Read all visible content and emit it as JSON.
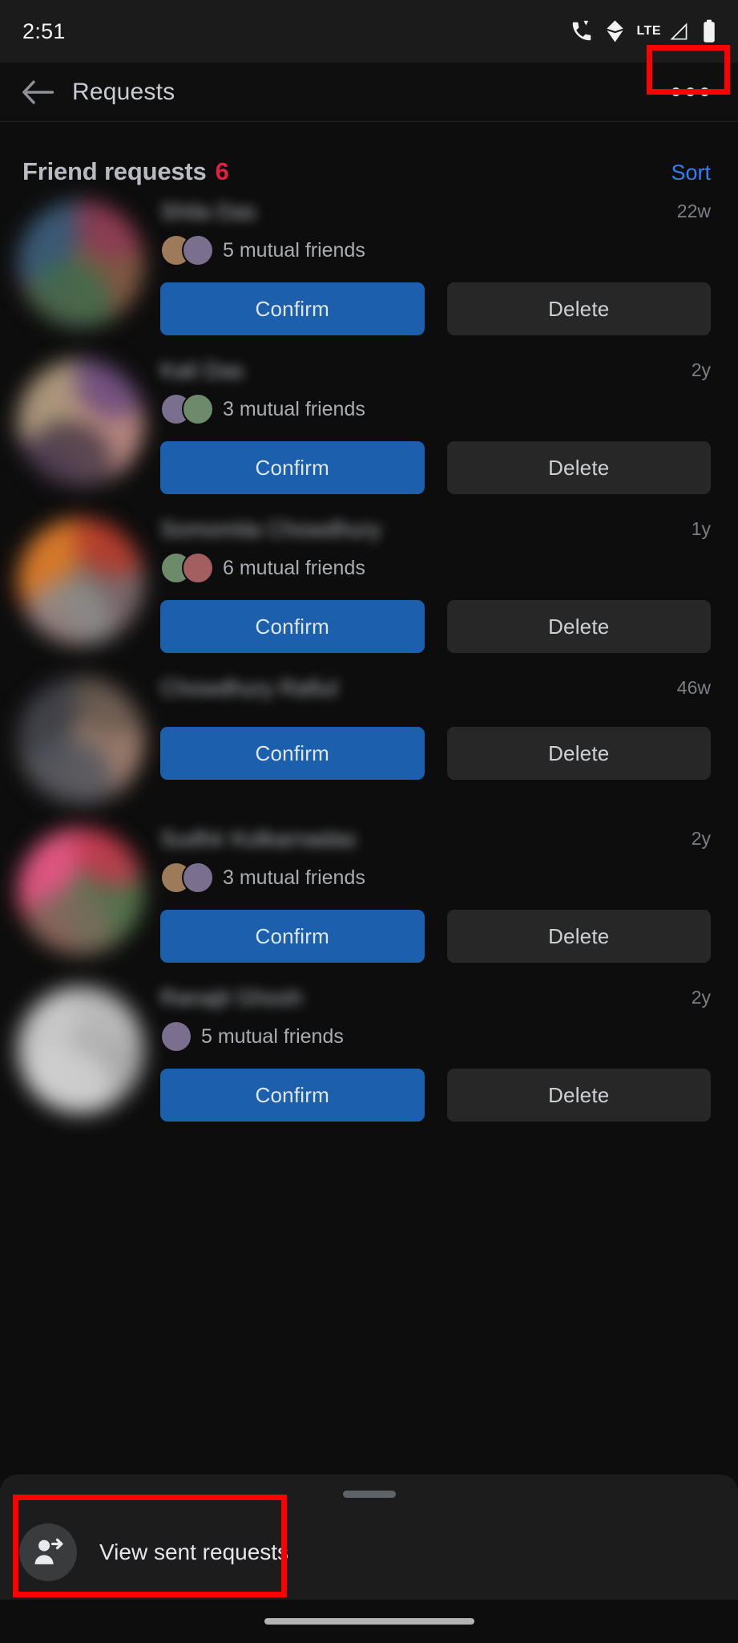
{
  "status_bar": {
    "time": "2:51",
    "network_label": "LTE",
    "icons": [
      "call-icon",
      "vpn-key-icon",
      "lte-label",
      "signal-icon",
      "battery-icon"
    ]
  },
  "app_bar": {
    "back_label": "back-arrow",
    "title": "Requests",
    "overflow_label": "More options"
  },
  "section": {
    "title": "Friend requests",
    "count": "6",
    "sort_label": "Sort"
  },
  "buttons": {
    "confirm": "Confirm",
    "delete": "Delete"
  },
  "requests": [
    {
      "name": "Shila Das",
      "time": "22w",
      "mutual": "5 mutual friends",
      "mutual_avatars": 2,
      "avatar_colors": [
        "#8e3a52",
        "#2b5f7a",
        "#7b5d3f",
        "#3f6b4b"
      ]
    },
    {
      "name": "Kali Das",
      "time": "2y",
      "mutual": "3 mutual friends",
      "mutual_avatars": 2,
      "avatar_colors": [
        "#6b4a7e",
        "#b5a27a",
        "#c08f7d",
        "#4b3c48"
      ]
    },
    {
      "name": "Somomita Chowdhury",
      "time": "1y",
      "mutual": "6 mutual friends",
      "mutual_avatars": 2,
      "avatar_colors": [
        "#b33a2a",
        "#d9822b",
        "#6d6f74",
        "#8c8c8c"
      ]
    },
    {
      "name": "Chowdhury Rafiul",
      "time": "46w",
      "mutual": "",
      "mutual_avatars": 0,
      "avatar_colors": [
        "#6a5a50",
        "#3a3e46",
        "#a08070",
        "#52565e"
      ]
    },
    {
      "name": "Sudhir Kolkarnadas",
      "time": "2y",
      "mutual": "3 mutual friends",
      "mutual_avatars": 2,
      "avatar_colors": [
        "#c0394b",
        "#e05a8a",
        "#3f7a4a",
        "#7a6b5c"
      ]
    },
    {
      "name": "Ranajit Ghosh",
      "time": "2y",
      "mutual": "5 mutual friends",
      "mutual_avatars": 1,
      "avatar_colors": [
        "#b9b9b9",
        "#c9c9c9",
        "#a8a8a8",
        "#d0d0d0"
      ]
    }
  ],
  "bottom_sheet": {
    "sent_requests_label": "View sent requests",
    "icon": "person-arrow-icon",
    "handle": "drag-handle"
  },
  "highlights": {
    "color": "#ff0000",
    "targets": [
      "overflow-menu-button",
      "view-sent-requests-row"
    ]
  },
  "colors": {
    "accent_blue": "#1b5fad",
    "link_blue": "#2e81f4",
    "badge_red": "#e41e3f",
    "background": "#0d0d0d",
    "surface": "#1c1c1c"
  }
}
